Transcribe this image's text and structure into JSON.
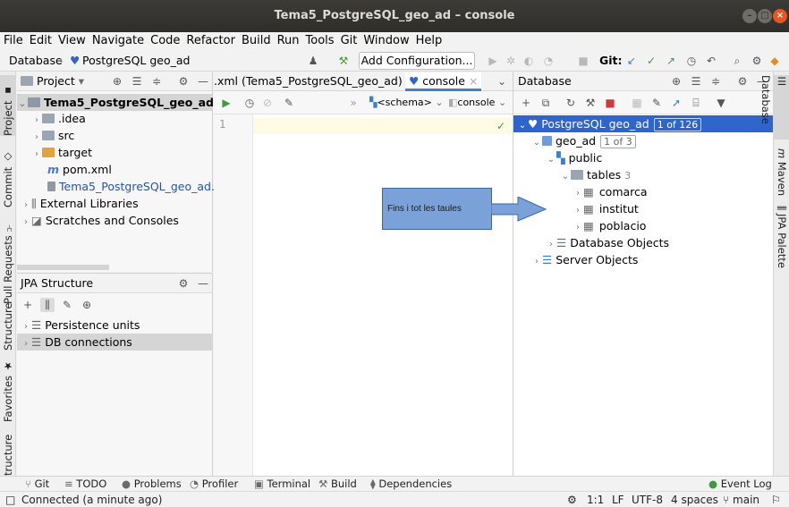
{
  "window": {
    "title": "Tema5_PostgreSQL_geo_ad – console"
  },
  "menu": [
    "File",
    "Edit",
    "View",
    "Navigate",
    "Code",
    "Refactor",
    "Build",
    "Run",
    "Tools",
    "Git",
    "Window",
    "Help"
  ],
  "nav": {
    "crumb1": "Database",
    "crumb2": "PostgreSQL geo_ad",
    "add_config": "Add Configuration...",
    "git_label": "Git:"
  },
  "left_stripe": {
    "project": "Project",
    "commit": "Commit",
    "pull_requests": "Pull Requests",
    "structure": "Structure",
    "favorites": "Favorites",
    "bottom": "tructure"
  },
  "right_stripe": {
    "database": "Database",
    "maven": "Maven",
    "jpa_palette": "JPA Palette"
  },
  "project_panel": {
    "title": "Project",
    "root": "Tema5_PostgreSQL_geo_ad",
    "items": [
      ".idea",
      "src",
      "target",
      "pom.xml",
      "Tema5_PostgreSQL_geo_ad.i",
      "External Libraries",
      "Scratches and Consoles"
    ]
  },
  "jpa_panel": {
    "title": "JPA Structure",
    "items": [
      "Persistence units",
      "DB connections"
    ]
  },
  "editor": {
    "tab_xml": ".xml (Tema5_PostgreSQL_geo_ad)",
    "tab_console": "console",
    "schema_label": "<schema>",
    "console_label": "console",
    "line_number": "1"
  },
  "db_panel": {
    "title": "Database",
    "root": "PostgreSQL geo_ad",
    "root_badge": "1 of 126",
    "db": "geo_ad",
    "db_badge": "1 of 3",
    "schema": "public",
    "tables_label": "tables",
    "tables_count": "3",
    "tables": [
      "comarca",
      "institut",
      "poblacio"
    ],
    "db_objects": "Database Objects",
    "server_objects": "Server Objects"
  },
  "callout": {
    "text": "Fins i tot les taules"
  },
  "bottom_tabs": [
    "Git",
    "TODO",
    "Problems",
    "Profiler",
    "Terminal",
    "Build",
    "Dependencies",
    "Event Log"
  ],
  "status": {
    "message": "Connected (a minute ago)",
    "position": "1:1",
    "line_sep": "LF",
    "encoding": "UTF-8",
    "indent": "4 spaces",
    "branch": "main"
  }
}
